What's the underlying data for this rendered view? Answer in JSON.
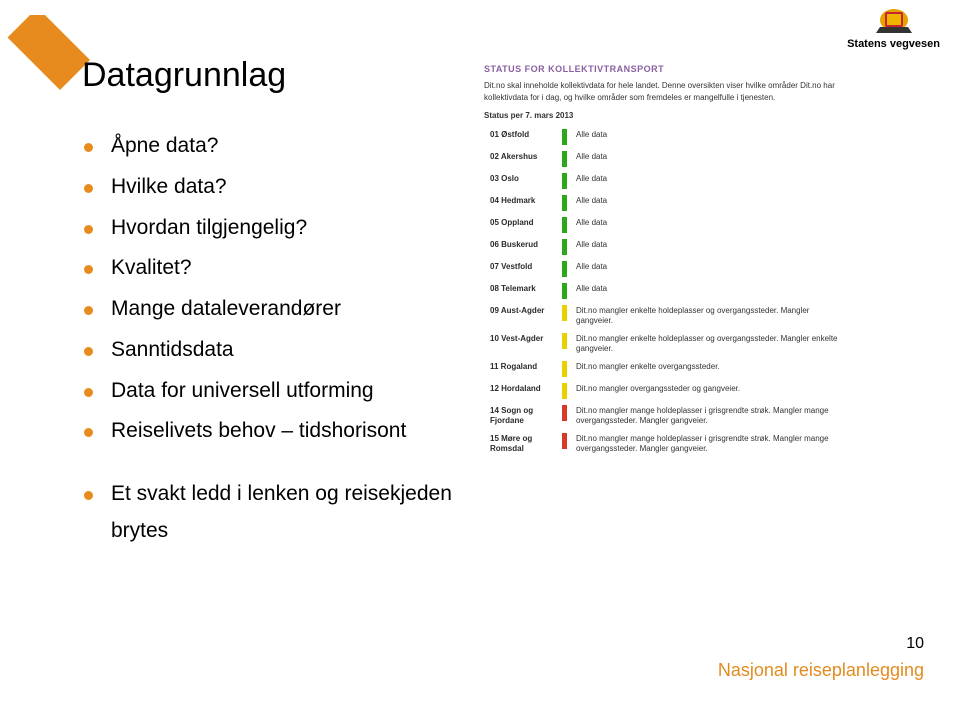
{
  "brand": {
    "name": "Statens vegvesen"
  },
  "title": "Datagrunnlag",
  "bullets": {
    "group1": [
      "Åpne data?",
      "Hvilke data?",
      "Hvordan tilgjengelig?",
      "Kvalitet?",
      "Mange dataleverandører",
      "Sanntidsdata",
      "Data for universell utforming",
      "Reiselivets behov – tidshorisont"
    ],
    "group2": [
      "Et svakt ledd i lenken og reisekjeden brytes"
    ]
  },
  "status": {
    "heading": "STATUS FOR KOLLEKTIVTRANSPORT",
    "intro": "Dit.no skal inneholde kollektivdata for hele landet. Denne oversikten viser hvilke områder Dit.no har kollektivdata for i dag, og hvilke områder som fremdeles er mangelfulle i tjenesten.",
    "date_label": "Status per 7. mars 2013",
    "rows": [
      {
        "code": "01 Østfold",
        "bar": "green",
        "desc": "Alle data"
      },
      {
        "code": "02 Akershus",
        "bar": "green",
        "desc": "Alle data"
      },
      {
        "code": "03 Oslo",
        "bar": "green",
        "desc": "Alle data"
      },
      {
        "code": "04 Hedmark",
        "bar": "green",
        "desc": "Alle data"
      },
      {
        "code": "05 Oppland",
        "bar": "green",
        "desc": "Alle data"
      },
      {
        "code": "06 Buskerud",
        "bar": "green",
        "desc": "Alle data"
      },
      {
        "code": "07 Vestfold",
        "bar": "green",
        "desc": "Alle data"
      },
      {
        "code": "08 Telemark",
        "bar": "green",
        "desc": "Alle data"
      },
      {
        "code": "09 Aust-Agder",
        "bar": "yellow",
        "desc": "Dit.no mangler enkelte holdeplasser og overgangssteder. Mangler gangveier."
      },
      {
        "code": "10 Vest-Agder",
        "bar": "yellow",
        "desc": "Dit.no mangler enkelte holdeplasser og overgangssteder. Mangler enkelte gangveier."
      },
      {
        "code": "11 Rogaland",
        "bar": "yellow",
        "desc": "Dit.no mangler enkelte overgangssteder."
      },
      {
        "code": "12 Hordaland",
        "bar": "yellow",
        "desc": "Dit.no mangler overgangssteder og gangveier."
      },
      {
        "code": "14 Sogn og Fjordane",
        "bar": "red",
        "desc": "Dit.no mangler mange holdeplasser i grisgrendte strøk. Mangler mange overgangssteder. Mangler gangveier."
      },
      {
        "code": "15 Møre og Romsdal",
        "bar": "red",
        "desc": "Dit.no mangler mange holdeplasser i grisgrendte strøk. Mangler mange overgangssteder. Mangler gangveier."
      }
    ]
  },
  "footer": {
    "page_no": "10",
    "text": "Nasjonal reiseplanlegging"
  },
  "colors": {
    "accent_orange": "#e88b1f",
    "purple_heading": "#8a5fa3",
    "bar_green": "#2aa81a",
    "bar_yellow": "#e6d200",
    "bar_red": "#d83a2a"
  }
}
